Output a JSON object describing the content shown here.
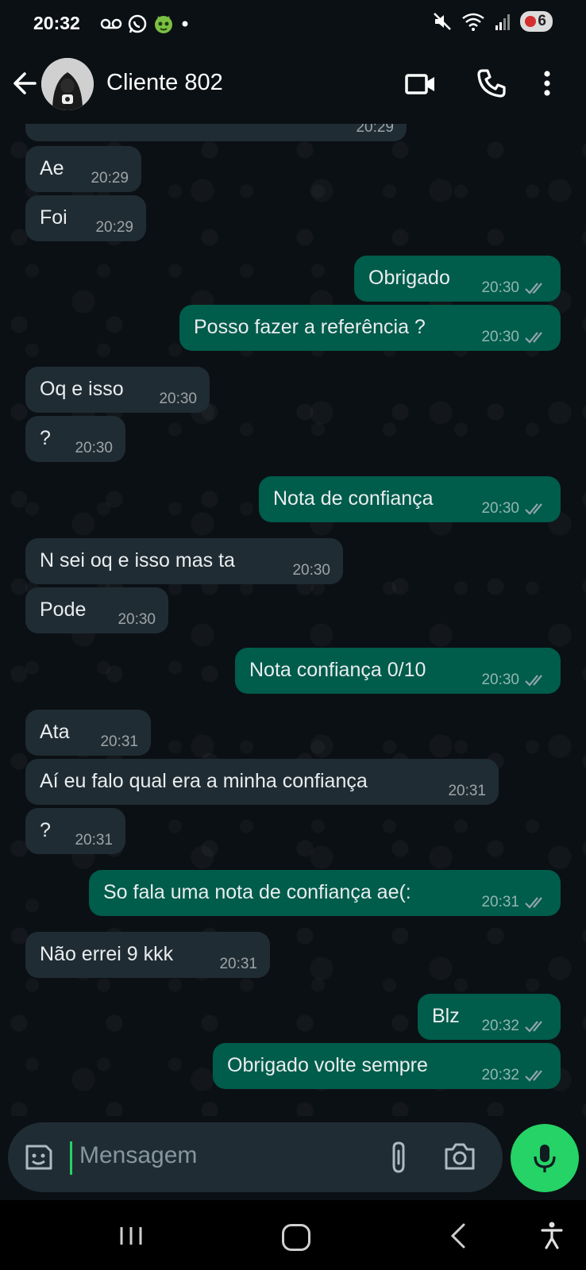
{
  "status_bar": {
    "time": "20:32",
    "left_icons": [
      "voicemail-icon",
      "whatsapp-icon",
      "alien-icon",
      "dot-icon"
    ],
    "right_icons": [
      "mute-icon",
      "wifi-icon",
      "signal-icon"
    ],
    "battery": "6"
  },
  "header": {
    "contact_name": "Cliente 802",
    "icons": [
      "back-arrow-icon",
      "video-call-icon",
      "voice-call-icon",
      "more-options-icon"
    ]
  },
  "messages": [
    {
      "dir": "in",
      "text": "",
      "time": "20:29"
    },
    {
      "dir": "in",
      "text": "Ae",
      "time": "20:29"
    },
    {
      "dir": "in",
      "text": "Foi",
      "time": "20:29"
    },
    {
      "dir": "out",
      "text": "Obrigado",
      "time": "20:30",
      "read": true
    },
    {
      "dir": "out",
      "text": "Posso fazer a referência ?",
      "time": "20:30",
      "read": true
    },
    {
      "dir": "in",
      "text": "Oq e isso",
      "time": "20:30"
    },
    {
      "dir": "in",
      "text": "?",
      "time": "20:30"
    },
    {
      "dir": "out",
      "text": "Nota de confiança",
      "time": "20:30",
      "read": true
    },
    {
      "dir": "in",
      "text": "N sei oq e isso mas ta",
      "time": "20:30"
    },
    {
      "dir": "in",
      "text": "Pode",
      "time": "20:30"
    },
    {
      "dir": "out",
      "text": "Nota confiança 0/10",
      "time": "20:30",
      "read": true
    },
    {
      "dir": "in",
      "text": "Ata",
      "time": "20:31"
    },
    {
      "dir": "in",
      "text": "Aí eu falo qual era a minha confiança",
      "time": "20:31"
    },
    {
      "dir": "in",
      "text": "?",
      "time": "20:31"
    },
    {
      "dir": "out",
      "text": "So fala uma nota de confiança ae(:",
      "time": "20:31",
      "read": true
    },
    {
      "dir": "in",
      "text": "Não errei 9 kkk",
      "time": "20:31"
    },
    {
      "dir": "out",
      "text": "Blz",
      "time": "20:32",
      "read": true
    },
    {
      "dir": "out",
      "text": "Obrigado volte sempre",
      "time": "20:32",
      "read": true
    }
  ],
  "input": {
    "placeholder": "Mensagem"
  },
  "colors": {
    "background": "#0b1014",
    "incoming_bubble": "#202c33",
    "outgoing_bubble": "#005c4b",
    "accent": "#25d366",
    "read_ticks": "#8fa4ae"
  }
}
